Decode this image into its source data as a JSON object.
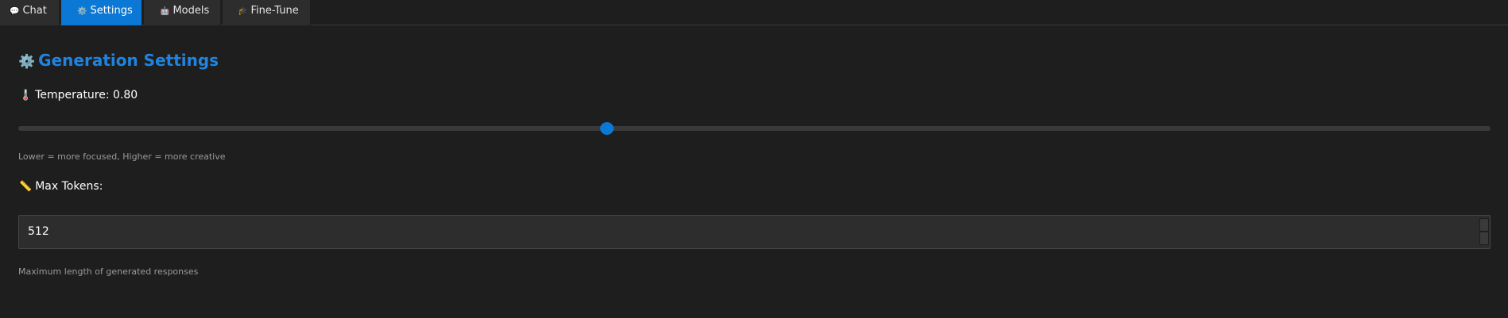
{
  "tabs": [
    {
      "label": "Chat",
      "icon": "speech-bubble-icon",
      "glyph": "💬",
      "active": false
    },
    {
      "label": "Settings",
      "icon": "gear-icon",
      "glyph": "⚙️",
      "active": true
    },
    {
      "label": "Models",
      "icon": "robot-icon",
      "glyph": "🤖",
      "active": false
    },
    {
      "label": "Fine-Tune",
      "icon": "graduation-cap-icon",
      "glyph": "🎓",
      "active": false
    }
  ],
  "settings": {
    "title": "Generation Settings",
    "title_icon": "⚙️",
    "temperature": {
      "icon": "🌡️",
      "label": "Temperature: 0.80",
      "value": 0.8,
      "min": 0,
      "max": 2,
      "hint": "Lower = more focused, Higher = more creative"
    },
    "max_tokens": {
      "icon": "📏",
      "label": "Max Tokens:",
      "value": "512",
      "hint": "Maximum length of generated responses"
    }
  },
  "colors": {
    "accent": "#0a78d4",
    "title": "#1f84e0",
    "background": "#1e1e1e"
  }
}
